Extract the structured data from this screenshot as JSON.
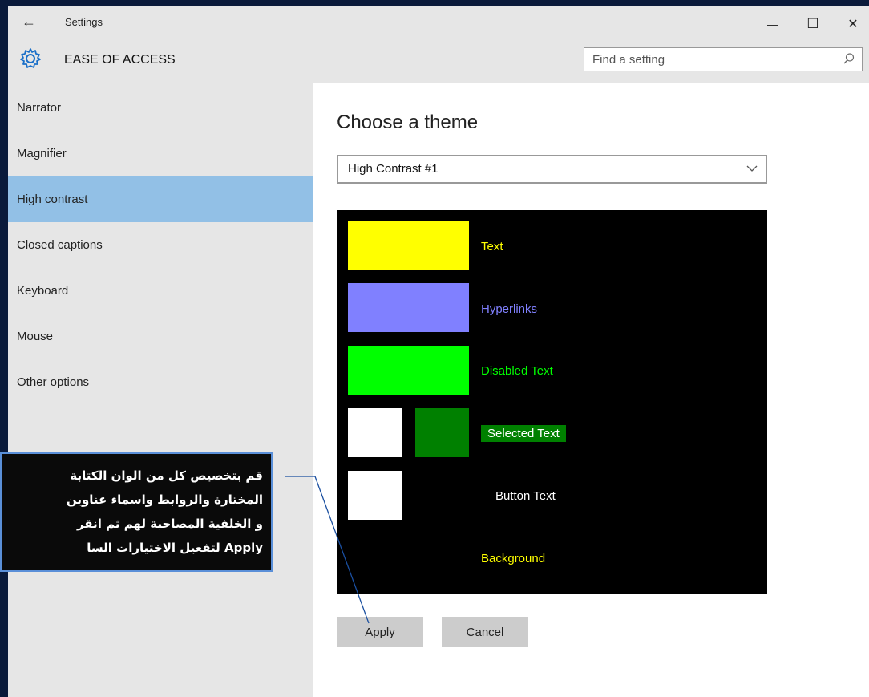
{
  "window": {
    "title": "Settings",
    "back_glyph": "←",
    "min_glyph": "—",
    "max_glyph": "☐",
    "close_glyph": "✕"
  },
  "header": {
    "section_title": "EASE OF ACCESS",
    "search_placeholder": "Find a setting"
  },
  "sidebar": {
    "items": [
      {
        "label": "Narrator"
      },
      {
        "label": "Magnifier"
      },
      {
        "label": "High contrast"
      },
      {
        "label": "Closed captions"
      },
      {
        "label": "Keyboard"
      },
      {
        "label": "Mouse"
      },
      {
        "label": "Other options"
      }
    ],
    "active_index": 2
  },
  "main": {
    "heading": "Choose a theme",
    "theme_selected": "High Contrast #1",
    "preview": {
      "text_label": "Text",
      "hyperlinks_label": "Hyperlinks",
      "disabled_label": "Disabled Text",
      "selected_label": "Selected Text",
      "button_label": "Button Text",
      "background_label": "Background"
    },
    "apply_label": "Apply",
    "cancel_label": "Cancel"
  },
  "colors": {
    "text": "#ffff00",
    "hyperlinks": "#8080ff",
    "disabled_text": "#00ff00",
    "selected_bg": "#008000",
    "button_face": "#ffffff",
    "background_label": "#ffff00",
    "active_nav": "#92c0e6"
  },
  "callout": {
    "lines": [
      "قم بتخصيص كل من الوان الكتابة",
      "المختارة والروابط واسماء عناوين",
      "و الخلفية المصاحبة لهم ثم انقر",
      "Apply لتفعيل الاختيارات السا"
    ]
  }
}
